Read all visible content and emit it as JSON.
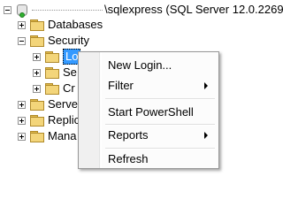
{
  "tree": {
    "server": {
      "name_suffix": "\\sqlexpress (SQL Server 12.0.2269 -"
    },
    "nodes": [
      {
        "label": "Databases"
      },
      {
        "label": "Security"
      },
      {
        "label": "Lo"
      },
      {
        "label": "Se"
      },
      {
        "label": "Cr"
      },
      {
        "label": "Server"
      },
      {
        "label": "Replic"
      },
      {
        "label": "Mana"
      }
    ]
  },
  "context_menu": {
    "items": [
      {
        "label": "New Login...",
        "has_submenu": false
      },
      {
        "label": "Filter",
        "has_submenu": true
      },
      {
        "label": "Start PowerShell",
        "has_submenu": false
      },
      {
        "label": "Reports",
        "has_submenu": true
      },
      {
        "label": "Refresh",
        "has_submenu": false
      }
    ]
  }
}
